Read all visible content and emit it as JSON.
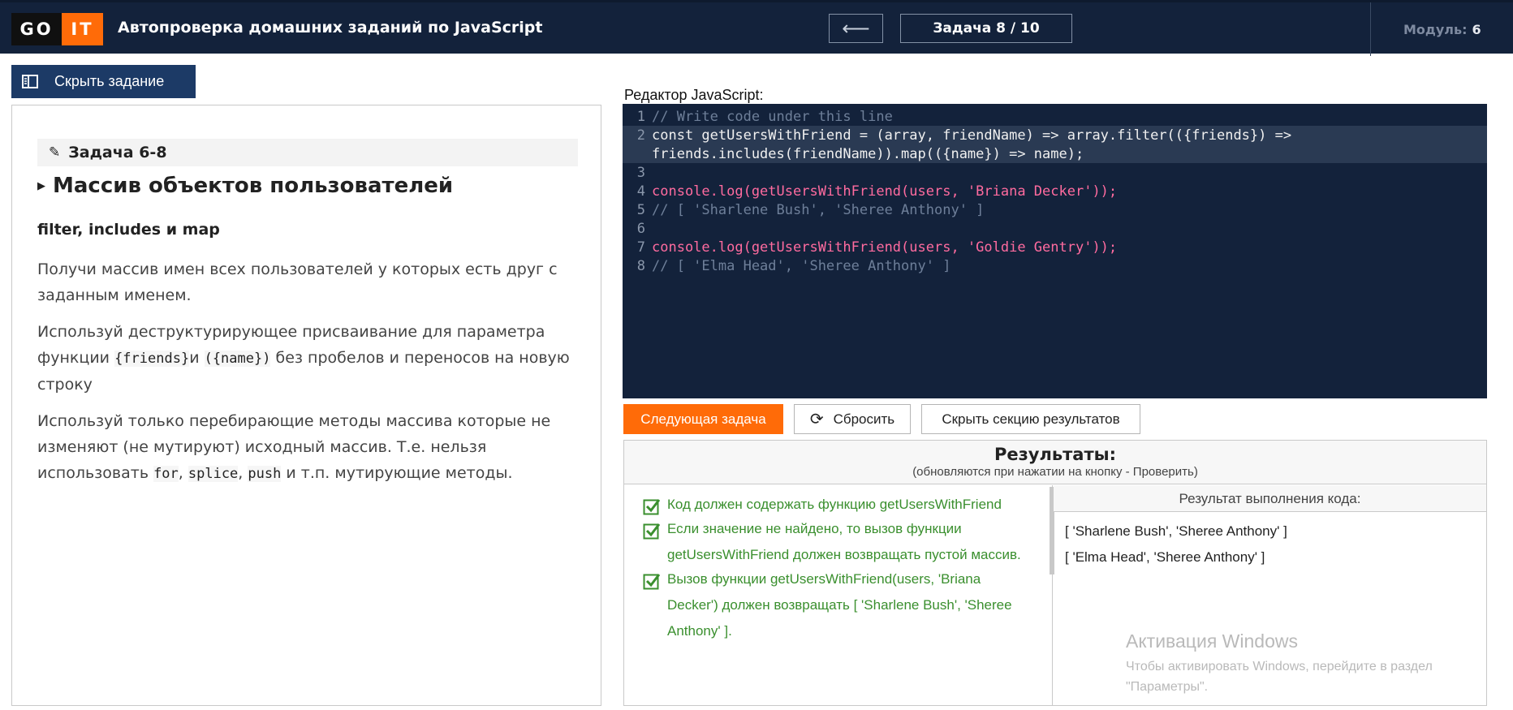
{
  "header": {
    "logo_left": "GO",
    "logo_right": "IT",
    "title": "Автопроверка домашних заданий по JavaScript",
    "back_arrow": "⟵",
    "task_counter": "Задача 8 / 10",
    "module_label": "Модуль:",
    "module_number": "6"
  },
  "sidebar_toggle": {
    "label": "Скрыть задание",
    "icon": "panel-icon"
  },
  "task": {
    "tag": "Задача 6-8",
    "heading": "Массив объектов пользователей",
    "subheading": "filter, includes и map",
    "p1": "Получи массив имен всех пользователей у которых есть друг с заданным именем.",
    "p2_before": "Используй деструктурирующее присваивание для параметра функции ",
    "p2_code1": "{friends}",
    "p2_mid": "и ",
    "p2_code2": "({name})",
    "p2_after": " без пробелов и переносов на новую строку",
    "p3_before": "Используй только перебирающие методы массива которые не изменяют (не мутируют) исходный массив. Т.е. нельзя использовать ",
    "p3_code1": "for",
    "p3_sep1": ", ",
    "p3_code2": "splice",
    "p3_sep2": ", ",
    "p3_code3": "push",
    "p3_after": " и т.п. мутирующие методы."
  },
  "editor": {
    "label": "Редактор JavaScript:",
    "line_numbers": [
      "1",
      "2",
      "3",
      "4",
      "5",
      "6",
      "7",
      "8"
    ],
    "lines": {
      "l1": "// Write code under this line",
      "l2a": "const getUsersWithFriend = (array, friendName) => array.filter(({friends}) =>",
      "l2b": "friends.includes(friendName)).map(({name}) => name);",
      "l4": "console.log(getUsersWithFriend(users, 'Briana Decker'));",
      "l5": "// [ 'Sharlene Bush', 'Sheree Anthony' ]",
      "l7": "console.log(getUsersWithFriend(users, 'Goldie Gentry'));",
      "l8": "// [ 'Elma Head', 'Sheree Anthony' ]"
    }
  },
  "actions": {
    "next": "Следующая задача",
    "reset": "Сбросить",
    "hide_results": "Скрыть секцию результатов"
  },
  "results": {
    "title": "Результаты:",
    "subtitle": "(обновляются при нажатии на кнопку - Проверить)",
    "checks": [
      "Код должен содержать функцию getUsersWithFriend",
      "Если значение не найдено, то вызов функции getUsersWithFriend должен возвращать пустой массив.",
      "Вызов функции getUsersWithFriend(users, 'Briana Decker') должен возвращать [ 'Sharlene Bush', 'Sheree Anthony' ]."
    ],
    "output_title": "Результат выполнения кода:",
    "output_lines": [
      "[ 'Sharlene Bush', 'Sheree Anthony' ]",
      "[ 'Elma Head', 'Sheree Anthony' ]"
    ]
  },
  "watermark": {
    "title": "Активация Windows",
    "subtitle": "Чтобы активировать Windows, перейдите в раздел \"Параметры\"."
  },
  "colors": {
    "header_bg": "#13223b",
    "accent_orange": "#ff6b08",
    "button_blue": "#1c3a66",
    "editor_bg": "#13223b",
    "success_green": "#3a8f2e"
  }
}
